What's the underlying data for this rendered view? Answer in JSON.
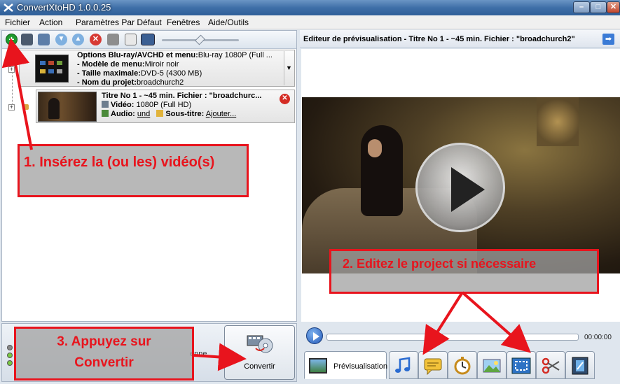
{
  "window": {
    "title": "ConvertXtoHD 1.0.0.25",
    "min_label": "–",
    "max_label": "□",
    "close_label": "✕"
  },
  "menu": [
    "Fichier",
    "Action",
    "Paramètres Par Défaut",
    "Fenêtres",
    "Aide/Outils"
  ],
  "toolbar": {
    "add_label": "+",
    "delete_label": "✕",
    "down_label": "▼",
    "up_label": "▲",
    "zoom_level": 0.5
  },
  "project": {
    "expander": "+",
    "options_label": "Options Blu-ray/AVCHD et menu:",
    "options_value": "Blu-ray 1080P (Full ...",
    "menu_model_label": "- Modèle de menu:",
    "menu_model_value": "Miroir noir",
    "max_size_label": "- Taille maximale:",
    "max_size_value": "DVD-5 (4300 MB)",
    "project_name_label": "- Nom du projet:",
    "project_name_value": "broadchurch2",
    "dropdown_arrow": "▼"
  },
  "title_item": {
    "expander": "+",
    "heading": "Titre No 1 - ~45 min. Fichier : \"broadchurc...",
    "video_label": "Vidéo:",
    "video_value": "1080P (Full HD)",
    "audio_label": "Audio:",
    "audio_value": "und",
    "subtitle_label": "Sous-titre:",
    "subtitle_value": "Ajouter...",
    "delete_label": "✕"
  },
  "bottom_left": {
    "partial_text": "enne",
    "convert_label": "Convertir"
  },
  "preview": {
    "header_title": "Editeur de prévisualisation - Titre No 1 - ~45 min. Fichier : \"broadchurch2\"",
    "header_arrow": "➡",
    "time": "00:00:00"
  },
  "tabs": {
    "preview_label": "Prévisualisation",
    "icons": [
      "music-icon",
      "subtitle-icon",
      "chapters-icon",
      "image-effects-icon",
      "crop-icon",
      "cut-icon",
      "film-icon"
    ]
  },
  "annotations": {
    "step1": "1. Insérez la (ou les) vidéo(s)",
    "step2": "2. Editez le project si nécessaire",
    "step3_line1": "3. Appuyez sur",
    "step3_line2": "Convertir"
  },
  "colors": {
    "annotation_red": "#e8141d",
    "titlebar_blue": "#3f6fa8"
  }
}
